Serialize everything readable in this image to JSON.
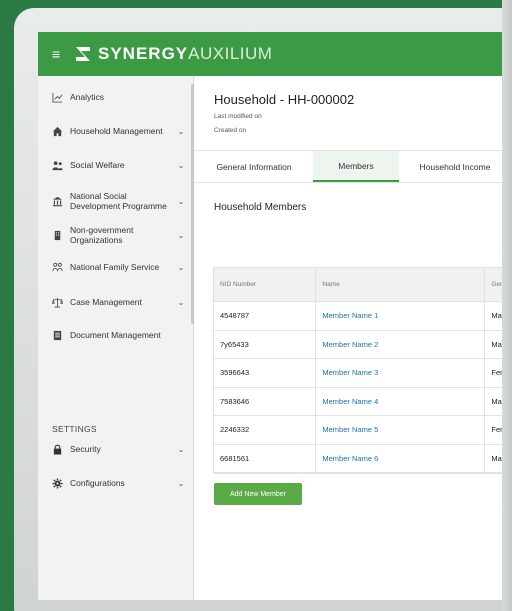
{
  "header": {
    "brand_primary": "SYNERGY",
    "brand_secondary": "AUXILIUM",
    "color": "#3c9a44"
  },
  "sidebar": {
    "items": [
      {
        "label": "Analytics",
        "icon": "chart-icon",
        "chevron": false
      },
      {
        "label": "Household Management",
        "icon": "home-icon",
        "chevron": true
      },
      {
        "label": "Social Welfare",
        "icon": "people-icon",
        "chevron": true
      },
      {
        "label": "National Social Development Programme",
        "icon": "bank-icon",
        "chevron": true
      },
      {
        "label": "Non-government Organizations",
        "icon": "building-icon",
        "chevron": true
      },
      {
        "label": "National Family Service",
        "icon": "family-icon",
        "chevron": true
      },
      {
        "label": "Case Management",
        "icon": "scale-icon",
        "chevron": true
      },
      {
        "label": "Document Management",
        "icon": "document-icon",
        "chevron": false
      }
    ],
    "settings_heading": "SETTINGS",
    "settings_items": [
      {
        "label": "Security",
        "icon": "lock-icon",
        "chevron": true
      },
      {
        "label": "Configurations",
        "icon": "gear-icon",
        "chevron": true
      }
    ]
  },
  "main": {
    "title": "Household - HH-000002",
    "last_modified": "Last modified on",
    "created": "Created on",
    "tabs": [
      {
        "label": "General Information",
        "active": false
      },
      {
        "label": "Members",
        "active": true
      },
      {
        "label": "Household Income",
        "active": false
      }
    ],
    "section_title": "Household Members",
    "table": {
      "headers": [
        "NID Number",
        "Name",
        "Gend"
      ],
      "rows": [
        [
          "4548787",
          "Member Name 1",
          "Male"
        ],
        [
          "7y65433",
          "Member Name 2",
          "Male"
        ],
        [
          "3596643",
          "Member Name 3",
          "Fem"
        ],
        [
          "7583646",
          "Member Name 4",
          "Male"
        ],
        [
          "2246332",
          "Member Name 5",
          "Fem"
        ],
        [
          "6681561",
          "Member Name 6",
          "Male"
        ]
      ]
    },
    "add_button": "Add New Member"
  }
}
